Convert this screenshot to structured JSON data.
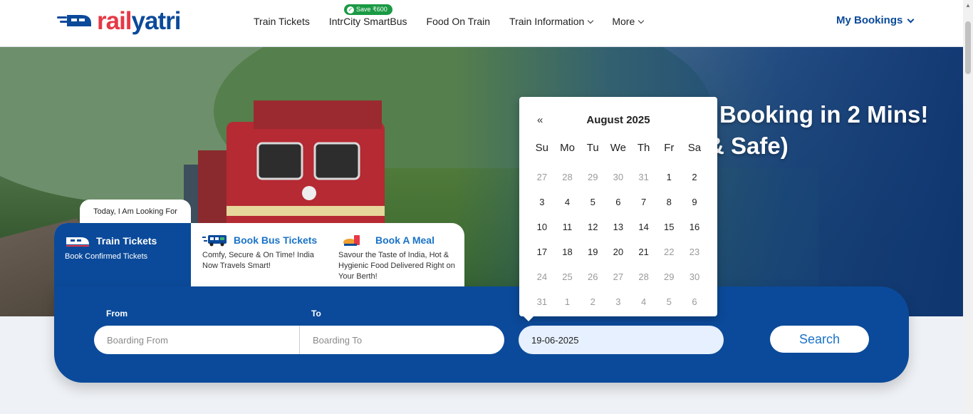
{
  "header": {
    "logo": {
      "rail": "rail",
      "yatri": "yatri"
    },
    "nav": [
      {
        "label": "Train Tickets",
        "dropdown": false
      },
      {
        "label": "IntrCity SmartBus",
        "dropdown": false
      },
      {
        "label": "Food On Train",
        "dropdown": false
      },
      {
        "label": "Train Information",
        "dropdown": true
      },
      {
        "label": "More",
        "dropdown": true
      }
    ],
    "save_badge": "Save ₹600",
    "my_bookings": "My Bookings"
  },
  "hero": {
    "headline_1": "Booking in 2 Mins!",
    "headline_2": "& Safe)"
  },
  "tabs": {
    "looking_for": "Today, I Am Looking For",
    "items": [
      {
        "title": "Train Tickets",
        "subtitle": "Book Confirmed Tickets",
        "active": true
      },
      {
        "title": "Book Bus Tickets",
        "subtitle": "Comfy, Secure & On Time! India Now Travels Smart!",
        "active": false
      },
      {
        "title": "Book A Meal",
        "subtitle": "Savour the Taste of India, Hot & Hygienic Food Delivered Right on Your Berth!",
        "active": false
      }
    ]
  },
  "search": {
    "from_label": "From",
    "to_label": "To",
    "from_placeholder": "Boarding From",
    "to_placeholder": "Boarding To",
    "date_value": "19-06-2025",
    "button": "Search"
  },
  "calendar": {
    "prev": "«",
    "month": "August 2025",
    "weekdays": [
      "Su",
      "Mo",
      "Tu",
      "We",
      "Th",
      "Fr",
      "Sa"
    ],
    "days": [
      {
        "d": "27",
        "m": true
      },
      {
        "d": "28",
        "m": true
      },
      {
        "d": "29",
        "m": true
      },
      {
        "d": "30",
        "m": true
      },
      {
        "d": "31",
        "m": true
      },
      {
        "d": "1",
        "m": false
      },
      {
        "d": "2",
        "m": false
      },
      {
        "d": "3",
        "m": false
      },
      {
        "d": "4",
        "m": false
      },
      {
        "d": "5",
        "m": false
      },
      {
        "d": "6",
        "m": false
      },
      {
        "d": "7",
        "m": false
      },
      {
        "d": "8",
        "m": false
      },
      {
        "d": "9",
        "m": false
      },
      {
        "d": "10",
        "m": false
      },
      {
        "d": "11",
        "m": false
      },
      {
        "d": "12",
        "m": false
      },
      {
        "d": "13",
        "m": false
      },
      {
        "d": "14",
        "m": false
      },
      {
        "d": "15",
        "m": false
      },
      {
        "d": "16",
        "m": false
      },
      {
        "d": "17",
        "m": false
      },
      {
        "d": "18",
        "m": false
      },
      {
        "d": "19",
        "m": false
      },
      {
        "d": "20",
        "m": false
      },
      {
        "d": "21",
        "m": false
      },
      {
        "d": "22",
        "m": true
      },
      {
        "d": "23",
        "m": true
      },
      {
        "d": "24",
        "m": true
      },
      {
        "d": "25",
        "m": true
      },
      {
        "d": "26",
        "m": true
      },
      {
        "d": "27",
        "m": true
      },
      {
        "d": "28",
        "m": true
      },
      {
        "d": "29",
        "m": true
      },
      {
        "d": "30",
        "m": true
      },
      {
        "d": "31",
        "m": true
      },
      {
        "d": "1",
        "m": true
      },
      {
        "d": "2",
        "m": true
      },
      {
        "d": "3",
        "m": true
      },
      {
        "d": "4",
        "m": true
      },
      {
        "d": "5",
        "m": true
      },
      {
        "d": "6",
        "m": true
      }
    ]
  },
  "colors": {
    "brand_blue": "#0b4a9a",
    "brand_red": "#e63946",
    "link_blue": "#1a73c8",
    "save_green": "#1a9a44"
  }
}
